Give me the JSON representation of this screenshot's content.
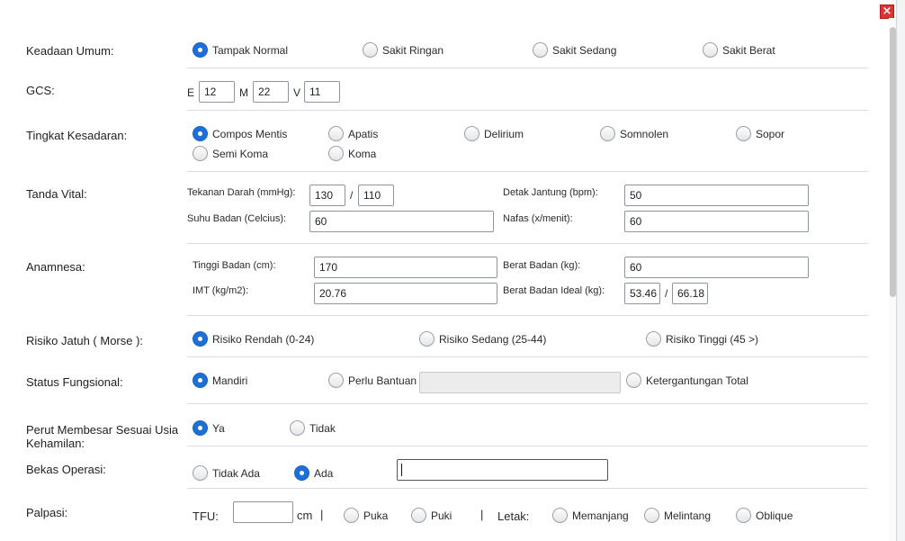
{
  "close_label": "×",
  "keadaan_umum": {
    "label": "Keadaan Umum:",
    "options": [
      "Tampak Normal",
      "Sakit Ringan",
      "Sakit Sedang",
      "Sakit Berat"
    ]
  },
  "gcs": {
    "label": "GCS:",
    "e_label": "E",
    "e_value": "12",
    "m_label": "M",
    "m_value": "22",
    "v_label": "V",
    "v_value": "11"
  },
  "kesadaran": {
    "label": "Tingkat Kesadaran:",
    "options": [
      "Compos Mentis",
      "Apatis",
      "Delirium",
      "Somnolen",
      "Sopor",
      "Semi Koma",
      "Koma"
    ]
  },
  "tanda_vital": {
    "label": "Tanda Vital:",
    "td_label": "Tekanan Darah (mmHg):",
    "td_sys": "130",
    "td_sep": "/",
    "td_dia": "110",
    "dj_label": "Detak Jantung (bpm):",
    "dj_value": "50",
    "suhu_label": "Suhu Badan (Celcius):",
    "suhu_value": "60",
    "nafas_label": "Nafas (x/menit):",
    "nafas_value": "60"
  },
  "anamnesa": {
    "label": "Anamnesa:",
    "tb_label": "Tinggi Badan (cm):",
    "tb_value": "170",
    "bb_label": "Berat Badan (kg):",
    "bb_value": "60",
    "imt_label": "IMT (kg/m2):",
    "imt_value": "20.76",
    "bbi_label": "Berat Badan Ideal (kg):",
    "bbi_min": "53.46",
    "bbi_sep": "/",
    "bbi_max": "66.18"
  },
  "risiko_jatuh": {
    "label": "Risiko Jatuh ( Morse ):",
    "options": [
      "Risiko Rendah (0-24)",
      "Risiko Sedang (25-44)",
      "Risiko Tinggi (45 >)"
    ]
  },
  "status_fungsional": {
    "label": "Status Fungsional:",
    "options": [
      "Mandiri",
      "Perlu Bantuan",
      "Ketergantungan Total"
    ],
    "bantuan_value": ""
  },
  "perut": {
    "label_line1": "Perut Membesar Sesuai Usia",
    "label_line2": "Kehamilan:",
    "options": [
      "Ya",
      "Tidak"
    ]
  },
  "bekas_operasi": {
    "label": "Bekas Operasi:",
    "options": [
      "Tidak Ada",
      "Ada"
    ],
    "detail_value": ""
  },
  "palpasi": {
    "label": "Palpasi:",
    "tfu_label": "TFU:",
    "tfu_value": "",
    "cm_label": "cm",
    "sep": "|",
    "options1": [
      "Puka",
      "Puki"
    ],
    "letak_label": "Letak:",
    "options2": [
      "Memanjang",
      "Melintang",
      "Oblique"
    ]
  }
}
